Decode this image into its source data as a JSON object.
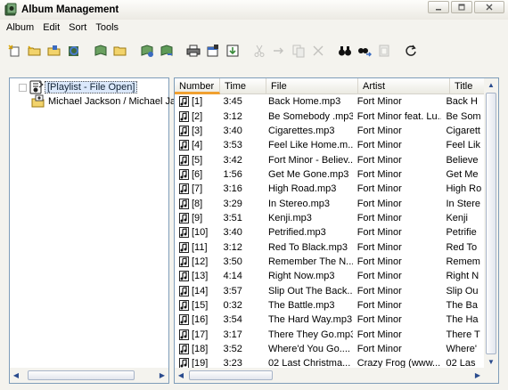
{
  "window": {
    "title": "Album Management",
    "icon": "app-book-icon",
    "controls": [
      "minimize-icon",
      "maximize-icon",
      "close-icon"
    ]
  },
  "menu": [
    "Album",
    "Edit",
    "Sort",
    "Tools"
  ],
  "toolbar": {
    "buttons": [
      {
        "name": "new-album-icon",
        "enabled": true
      },
      {
        "name": "open-folder-icon",
        "enabled": true
      },
      {
        "name": "save-icon",
        "enabled": true
      },
      {
        "name": "refresh-album-icon",
        "enabled": true
      },
      {
        "name": "folder-icon",
        "enabled": true
      },
      {
        "name": "book-green-icon",
        "enabled": true
      },
      {
        "name": "book-add-icon",
        "enabled": true
      },
      {
        "name": "print-icon",
        "enabled": true
      },
      {
        "name": "properties-icon",
        "enabled": true
      },
      {
        "name": "export-icon",
        "enabled": true
      },
      {
        "name": "cut-icon",
        "enabled": false
      },
      {
        "name": "copy-icon",
        "enabled": false
      },
      {
        "name": "paste-icon",
        "enabled": false
      },
      {
        "name": "delete-icon",
        "enabled": false
      },
      {
        "name": "binoculars-icon",
        "enabled": true
      },
      {
        "name": "find-replace-icon",
        "enabled": true
      },
      {
        "name": "clipboard-icon",
        "enabled": false
      },
      {
        "name": "loop-icon",
        "enabled": true
      }
    ]
  },
  "tree": {
    "items": [
      {
        "label": "[Playlist - File Open]",
        "selected": true,
        "icon": "playlist-icon"
      },
      {
        "label": "Michael Jackson / Michael Ja",
        "selected": false,
        "icon": "album-folder-icon"
      }
    ]
  },
  "list": {
    "columns": [
      "Number",
      "Time",
      "File",
      "Artist",
      "Title"
    ],
    "sorted_column": "Number",
    "rows": [
      {
        "number": "[1]",
        "time": "3:45",
        "file": "Back Home.mp3",
        "artist": "Fort Minor",
        "title": "Back H"
      },
      {
        "number": "[2]",
        "time": "3:12",
        "file": "Be Somebody .mp3",
        "artist": "Fort Minor feat. Lu...",
        "title": "Be Som"
      },
      {
        "number": "[3]",
        "time": "3:40",
        "file": "Cigarettes.mp3",
        "artist": "Fort Minor",
        "title": "Cigarett"
      },
      {
        "number": "[4]",
        "time": "3:53",
        "file": "Feel Like Home.m...",
        "artist": "Fort Minor",
        "title": "Feel Lik"
      },
      {
        "number": "[5]",
        "time": "3:42",
        "file": "Fort Minor - Believ...",
        "artist": "Fort Minor",
        "title": "Believe"
      },
      {
        "number": "[6]",
        "time": "1:56",
        "file": "Get Me Gone.mp3",
        "artist": "Fort Minor",
        "title": "Get Me"
      },
      {
        "number": "[7]",
        "time": "3:16",
        "file": "High Road.mp3",
        "artist": "Fort Minor",
        "title": "High Ro"
      },
      {
        "number": "[8]",
        "time": "3:29",
        "file": "In Stereo.mp3",
        "artist": "Fort Minor",
        "title": "In Stere"
      },
      {
        "number": "[9]",
        "time": "3:51",
        "file": "Kenji.mp3",
        "artist": "Fort Minor",
        "title": "Kenji"
      },
      {
        "number": "[10]",
        "time": "3:40",
        "file": "Petrified.mp3",
        "artist": "Fort Minor",
        "title": "Petrifie"
      },
      {
        "number": "[11]",
        "time": "3:12",
        "file": "Red To Black.mp3",
        "artist": "Fort Minor",
        "title": "Red To"
      },
      {
        "number": "[12]",
        "time": "3:50",
        "file": "Remember The N...",
        "artist": "Fort Minor",
        "title": "Remem"
      },
      {
        "number": "[13]",
        "time": "4:14",
        "file": "Right Now.mp3",
        "artist": "Fort Minor",
        "title": "Right N"
      },
      {
        "number": "[14]",
        "time": "3:57",
        "file": "Slip Out The Back...",
        "artist": "Fort Minor",
        "title": "Slip Ou"
      },
      {
        "number": "[15]",
        "time": "0:32",
        "file": "The Battle.mp3",
        "artist": "Fort Minor",
        "title": "The Ba"
      },
      {
        "number": "[16]",
        "time": "3:54",
        "file": "The Hard Way.mp3",
        "artist": "Fort Minor",
        "title": "The Ha"
      },
      {
        "number": "[17]",
        "time": "3:17",
        "file": "There They Go.mp3",
        "artist": "Fort Minor",
        "title": "There T"
      },
      {
        "number": "[18]",
        "time": "3:52",
        "file": "Where'd You Go....",
        "artist": "Fort Minor",
        "title": "Where'"
      },
      {
        "number": "[19]",
        "time": "3:23",
        "file": "02   Last Christma...",
        "artist": "Crazy Frog (www....",
        "title": "02   Las"
      }
    ]
  }
}
